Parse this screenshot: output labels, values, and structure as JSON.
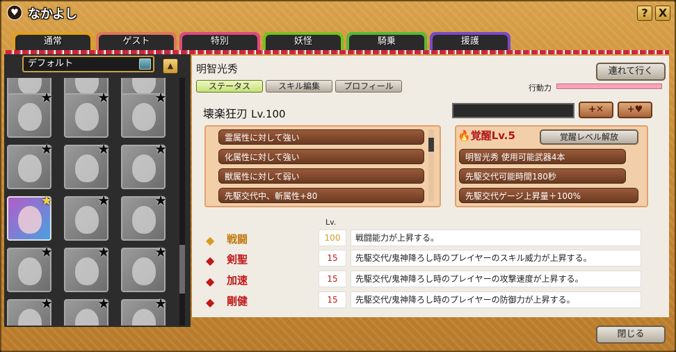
{
  "window": {
    "title": "なかよし",
    "help_label": "?",
    "close_label": "X"
  },
  "tabs": [
    {
      "label": "通常",
      "color": "#e0a020"
    },
    {
      "label": "ゲスト",
      "color": "#e07858"
    },
    {
      "label": "特別",
      "color": "#e04880",
      "active": true
    },
    {
      "label": "妖怪",
      "color": "#78c020"
    },
    {
      "label": "騎乗",
      "color": "#58b838"
    },
    {
      "label": "援護",
      "color": "#7a4ac8"
    }
  ],
  "list": {
    "dropdown_value": "デフォルト",
    "sort_label": "▲"
  },
  "character": {
    "name": "明智光秀",
    "follow_label": "連れて行く",
    "subtabs": [
      "ステータス",
      "スキル編集",
      "プロフィール"
    ],
    "gauge_label": "行動力",
    "weapon_name": "壊楽狂刃",
    "weapon_level": "Lv.100",
    "sym_btn1": "+✕",
    "sym_btn2": "+♥",
    "attributes": [
      "霊属性に対して強い",
      "化属性に対して強い",
      "獣属性に対して弱い",
      "先駆交代中、斬属性+80"
    ],
    "awaken_title": "覚醒Lv.5",
    "awaken_button": "覚醒レベル解放",
    "awaken_effects": [
      "明智光秀 使用可能武器4本",
      "先駆交代可能時間180秒",
      "先駆交代ゲージ上昇量＋100%"
    ],
    "lv_header": "Lv.",
    "skills": [
      {
        "name": "戦闘",
        "lv": "100",
        "desc": "戦闘能力が上昇する。",
        "color": "gold"
      },
      {
        "name": "剣聖",
        "lv": "15",
        "desc": "先駆交代/鬼神降ろし時のプレイヤーのスキル威力が上昇する。",
        "color": "red"
      },
      {
        "name": "加速",
        "lv": "15",
        "desc": "先駆交代/鬼神降ろし時のプレイヤーの攻撃速度が上昇する。",
        "color": "red"
      },
      {
        "name": "剛健",
        "lv": "15",
        "desc": "先駆交代/鬼神降ろし時のプレイヤーの防御力が上昇する。",
        "color": "red"
      }
    ]
  },
  "footer": {
    "close_label": "閉じる"
  }
}
